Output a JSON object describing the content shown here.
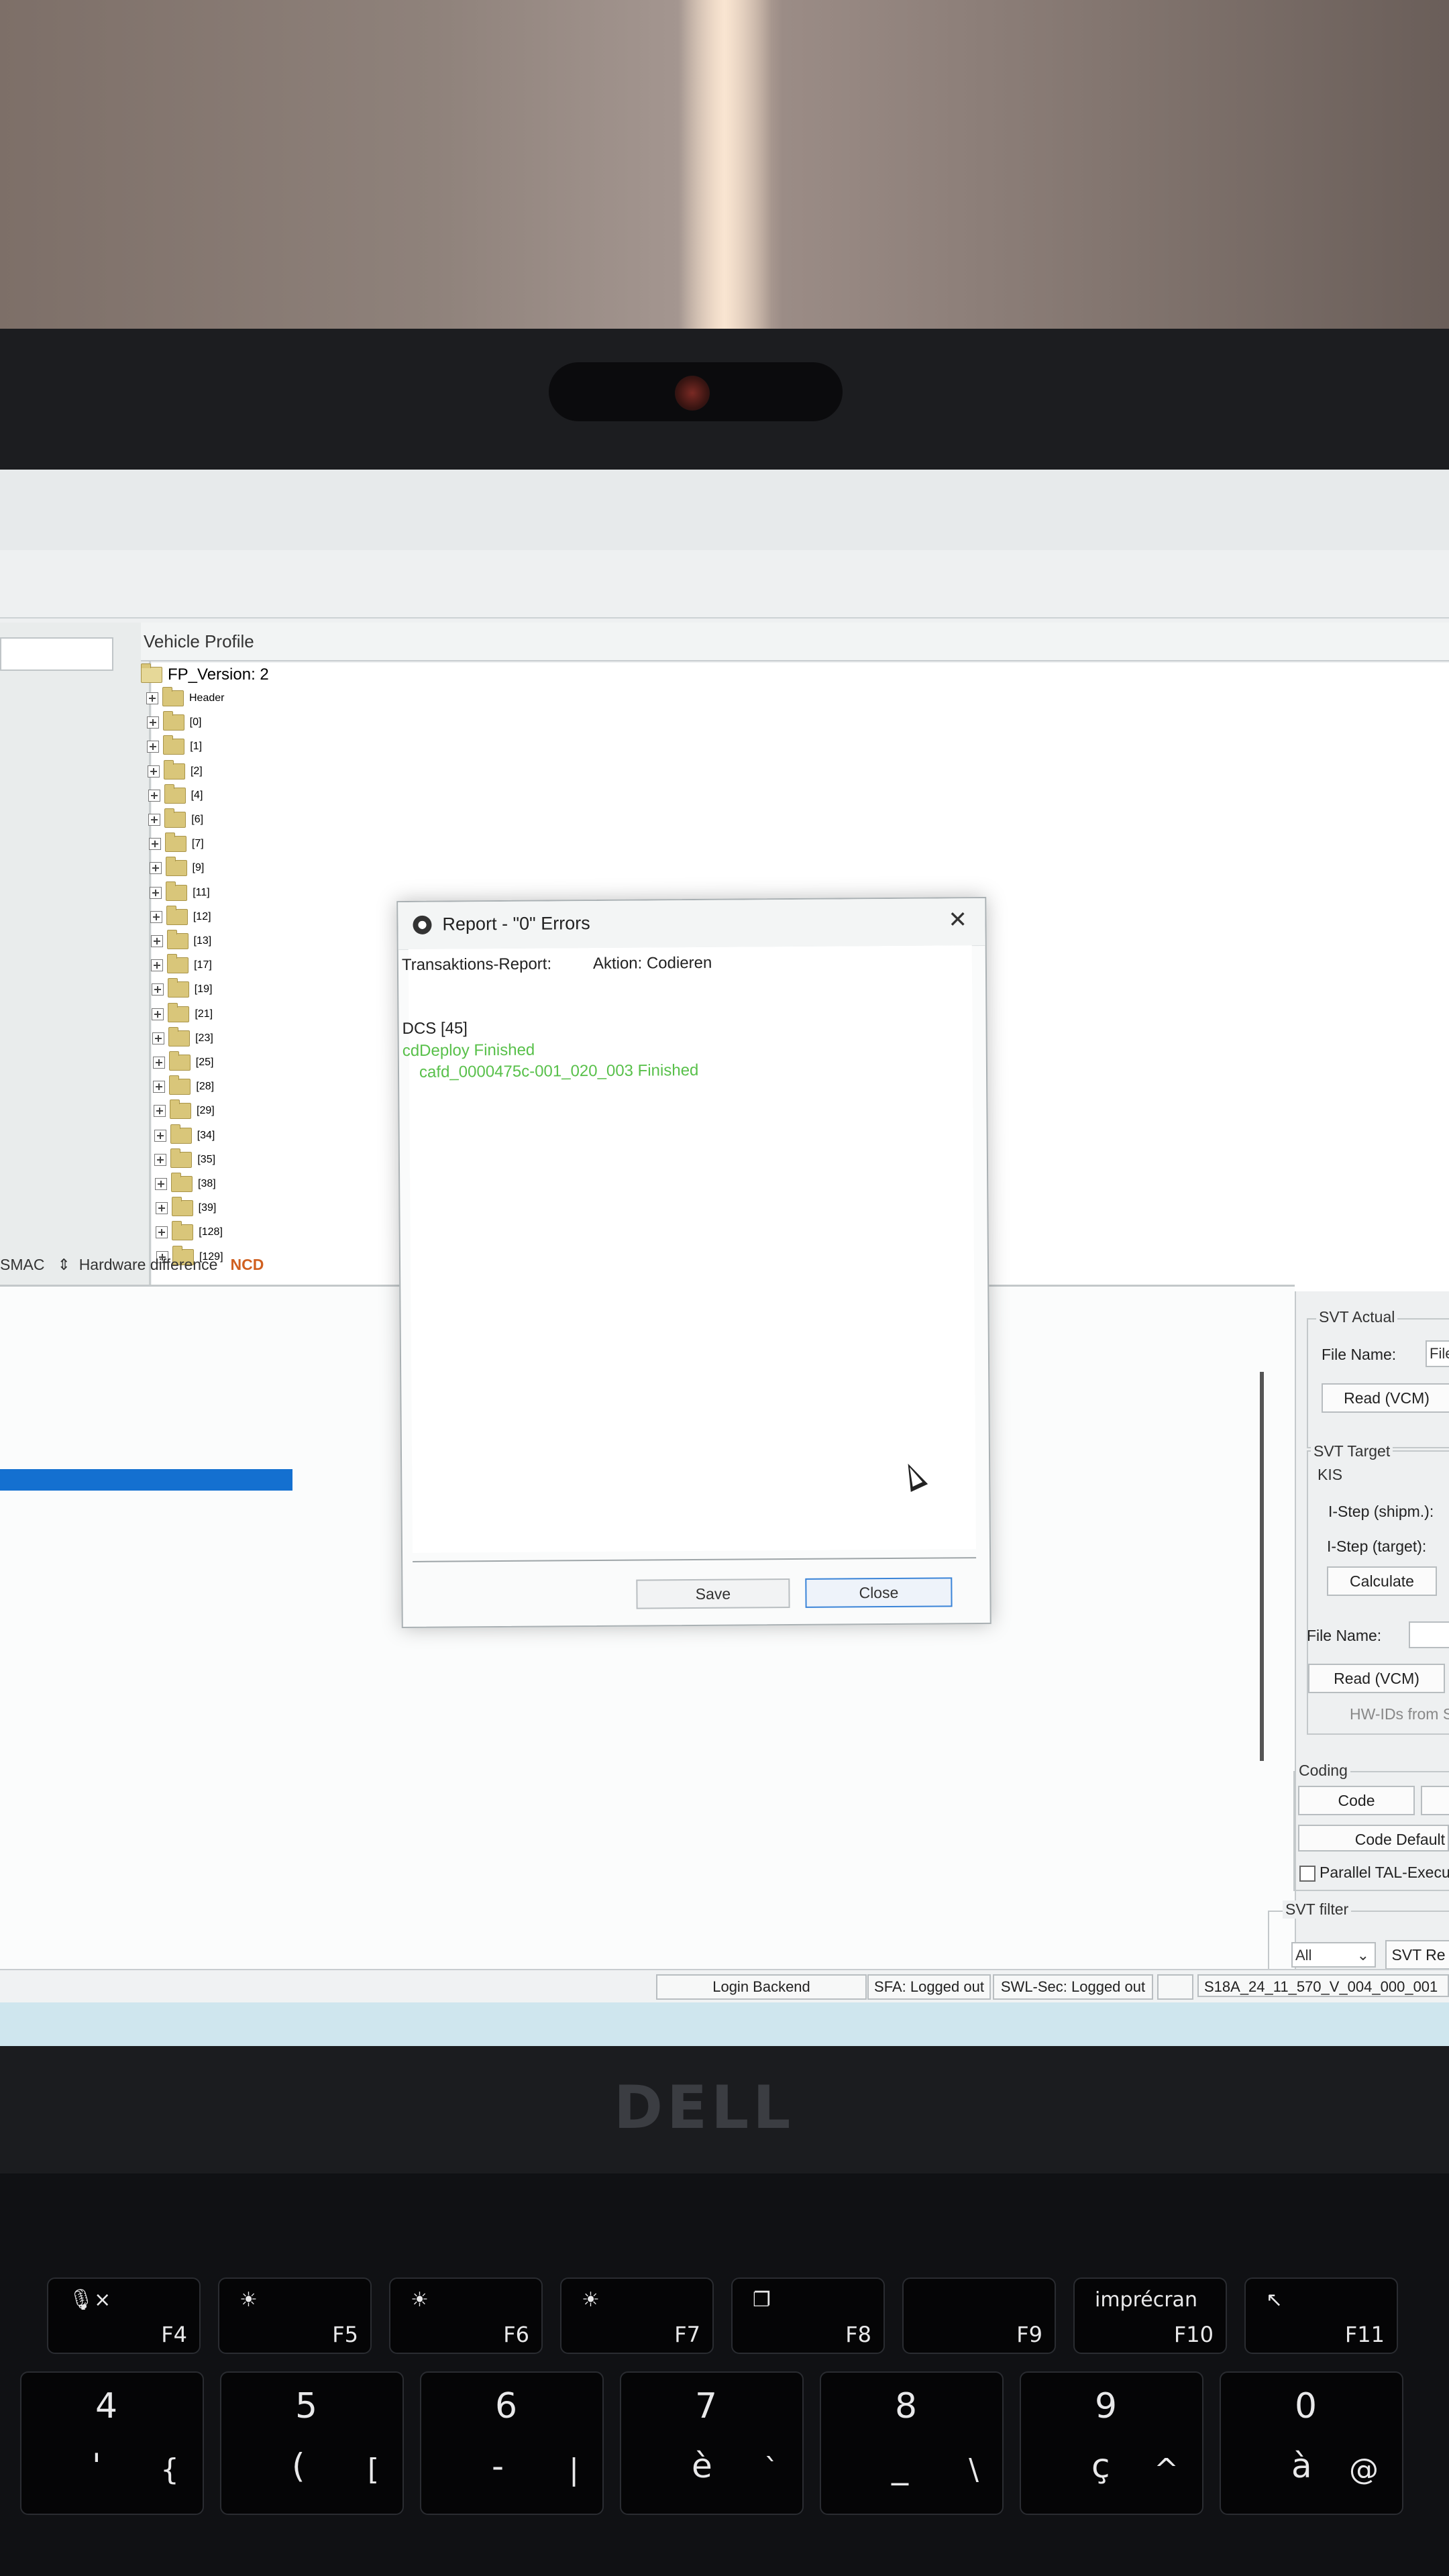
{
  "vehicle_profile": {
    "header": "Vehicle Profile",
    "root": "FP_Version: 2",
    "nodes": [
      "Header",
      "[0]",
      "[1]",
      "[2]",
      "[4]",
      "[6]",
      "[7]",
      "[9]",
      "[11]",
      "[12]",
      "[13]",
      "[17]",
      "[19]",
      "[21]",
      "[23]",
      "[25]",
      "[28]",
      "[29]",
      "[34]",
      "[35]",
      "[38]",
      "[39]",
      "[128]",
      "[129]"
    ]
  },
  "dialog": {
    "title": "Report - \"0\" Errors",
    "header_left": "Transaktions-Report:",
    "header_right": "Aktion: Codieren",
    "dcs": "DCS [45]",
    "line1": "cdDeploy Finished",
    "line2": "cafd_0000475c-001_020_003 Finished",
    "save": "Save",
    "close": "Close"
  },
  "status_line": {
    "prefix": "SMAC",
    "text": "Hardware difference",
    "badge": "NCD"
  },
  "right_panel": {
    "svt_actual": "SVT Actual",
    "file_name": "File Name:",
    "file_value": "File",
    "read_vcm": "Read (VCM)",
    "svt_target": "SVT Target",
    "kis": "KIS",
    "istep_shipm": "I-Step (shipm.):",
    "istep_target": "I-Step (target):",
    "calculate": "Calculate",
    "file_name2": "File Name:",
    "read_vcm2": "Read (VCM)",
    "hw_ids": "HW-IDs from S",
    "coding": "Coding",
    "code": "Code",
    "code_default": "Code Default",
    "parallel": "Parallel TAL-Execu",
    "svt_filter": "SVT filter",
    "filter_value": "All",
    "svt_re": "SVT Re"
  },
  "statusbar": {
    "login": "Login Backend",
    "sfa": "SFA: Logged out",
    "swl": "SWL-Sec: Logged out",
    "version": "S18A_24_11_570_V_004_000_001"
  },
  "brand": "DELL",
  "keyboard": {
    "fkeys": [
      {
        "icon": "🎙×",
        "label": "F4"
      },
      {
        "icon": "☀",
        "label": "F5"
      },
      {
        "icon": "☀",
        "label": "F6"
      },
      {
        "icon": "☀",
        "label": "F7"
      },
      {
        "icon": "❐",
        "label": "F8"
      },
      {
        "icon": "",
        "label": "F9"
      },
      {
        "icon": "imprécran",
        "label": "F10"
      },
      {
        "icon": "↖",
        "label": "F11"
      }
    ],
    "numkeys": [
      {
        "top": "4",
        "bottom": "'",
        "alt": "{"
      },
      {
        "top": "5",
        "bottom": "(",
        "alt": "["
      },
      {
        "top": "6",
        "bottom": "-",
        "alt": "|"
      },
      {
        "top": "7",
        "bottom": "è",
        "alt": "`"
      },
      {
        "top": "8",
        "bottom": "_",
        "alt": "\\"
      },
      {
        "top": "9",
        "bottom": "ç",
        "alt": "^"
      },
      {
        "top": "0",
        "bottom": "à",
        "alt": "@"
      }
    ]
  },
  "colors": {
    "accent_blue": "#1470d0",
    "finished_green": "#58c04a",
    "ncd_orange": "#d06020"
  }
}
